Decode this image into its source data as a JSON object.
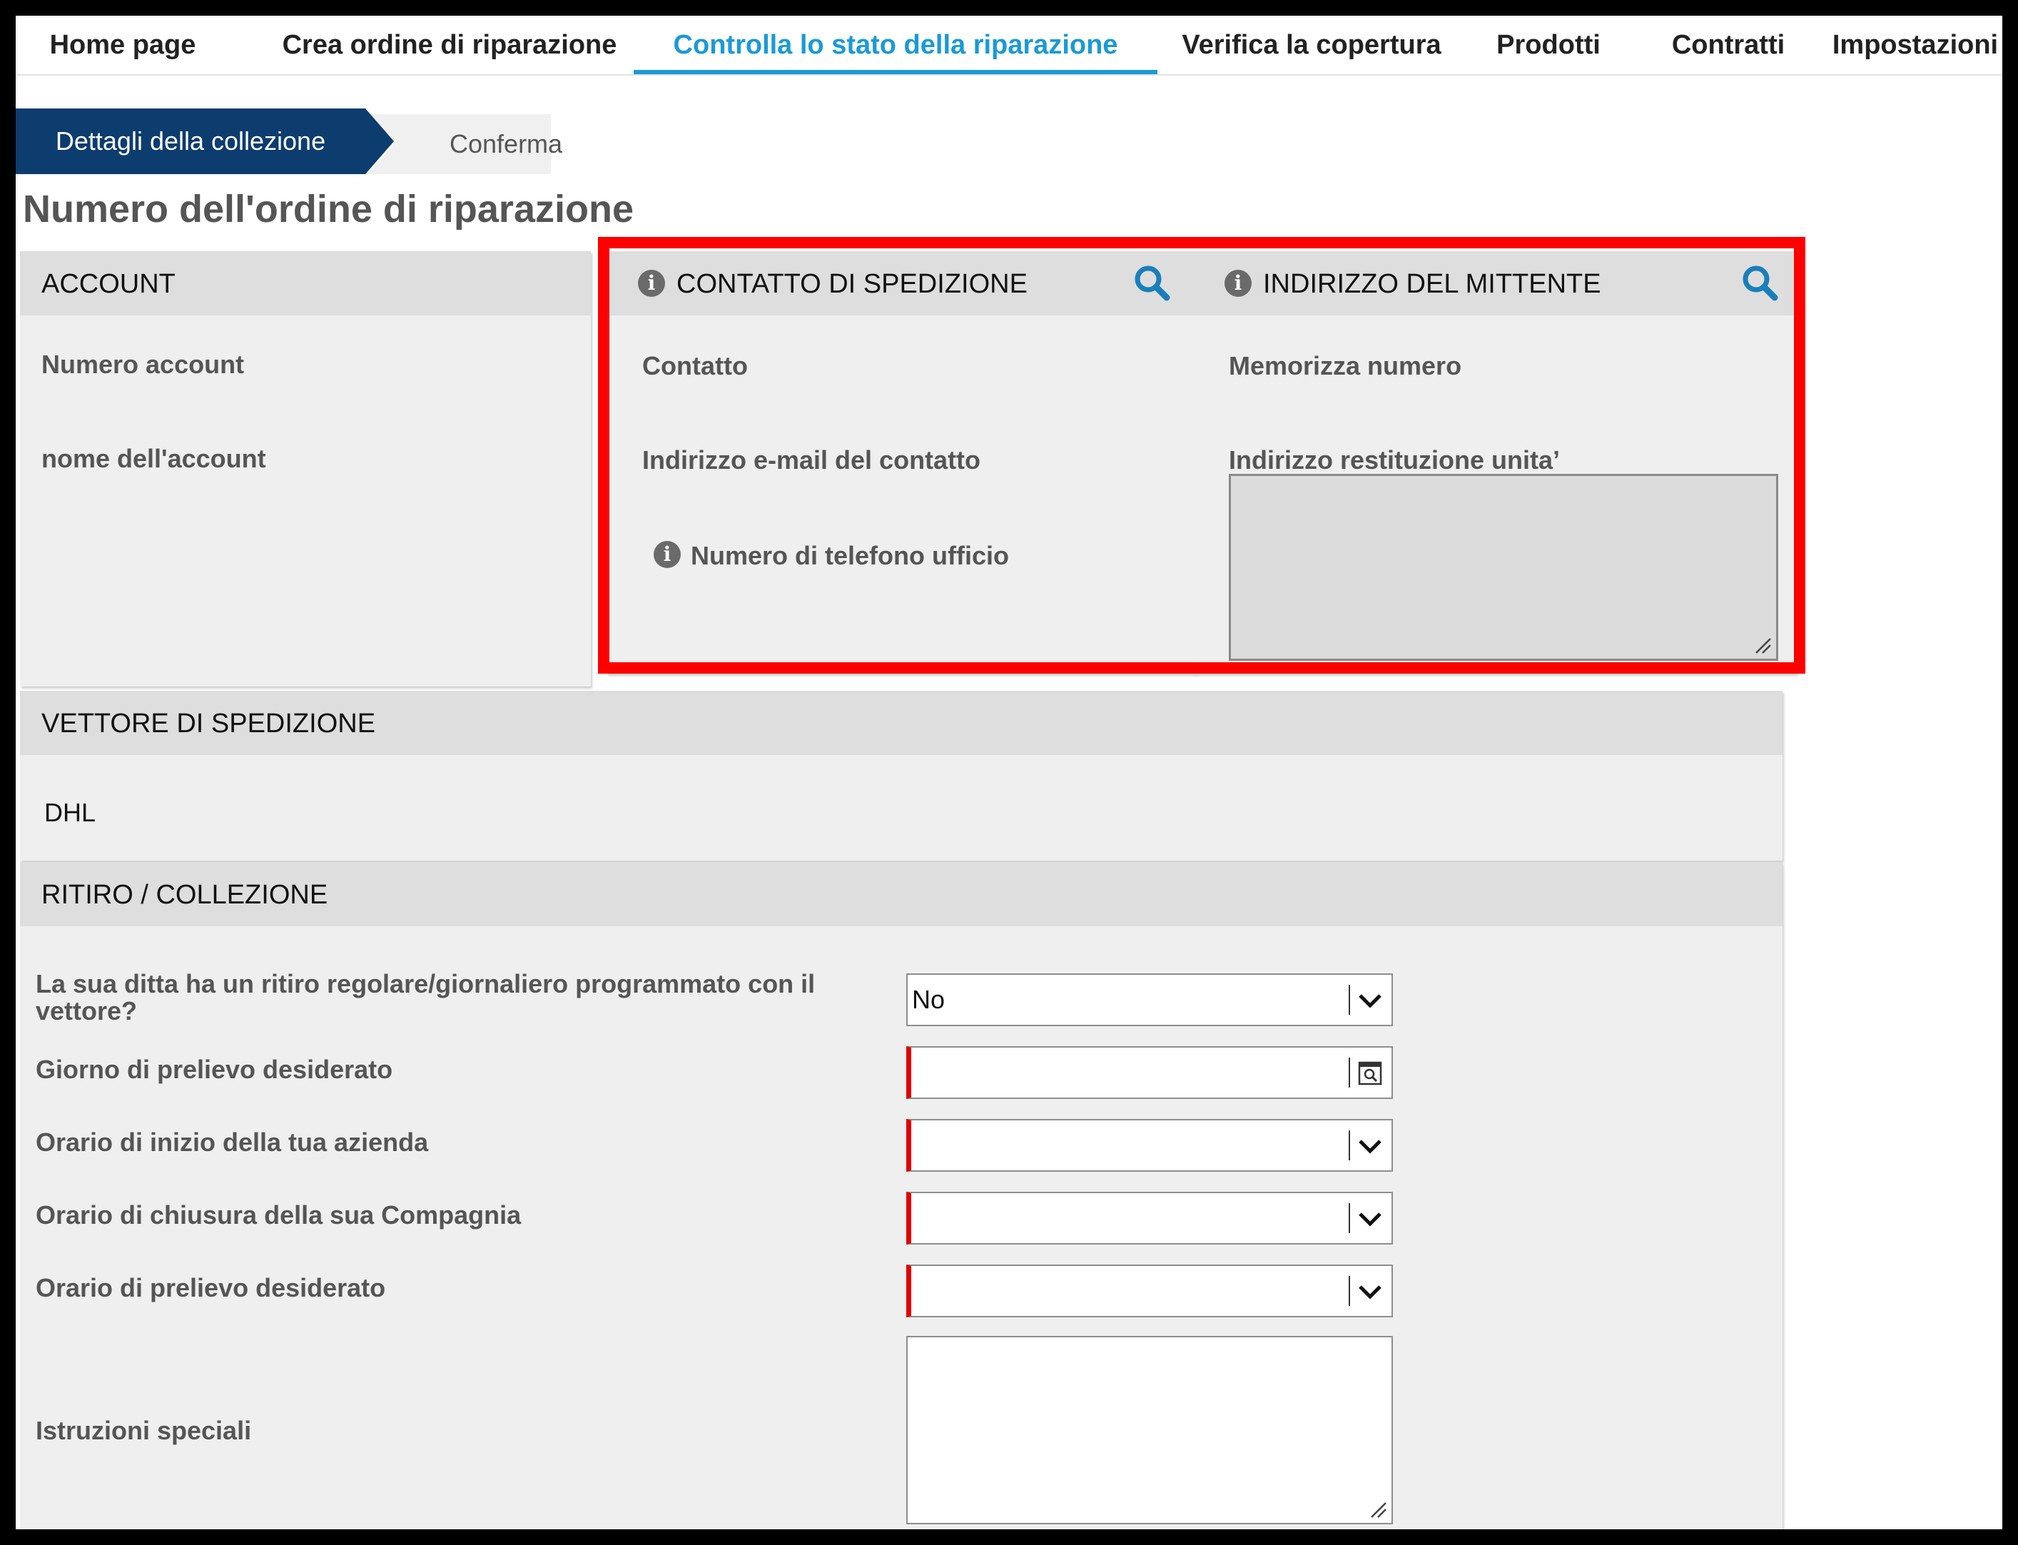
{
  "nav": {
    "tabs": [
      {
        "label": "Home page"
      },
      {
        "label": "Crea ordine di riparazione"
      },
      {
        "label": "Controlla lo stato della riparazione"
      },
      {
        "label": "Verifica la copertura"
      },
      {
        "label": "Prodotti"
      },
      {
        "label": "Contratti"
      },
      {
        "label": "Impostazioni"
      }
    ],
    "active_index": 2
  },
  "steps": [
    {
      "label": "Dettagli della collezione",
      "active": true
    },
    {
      "label": "Conferma",
      "active": false
    }
  ],
  "page_title": "Numero dell'ordine di riparazione",
  "account": {
    "header": "ACCOUNT",
    "fields": [
      "Numero account",
      "nome dell'account"
    ]
  },
  "shipping_contact": {
    "header": "CONTATTO DI SPEDIZIONE",
    "fields": [
      "Contatto",
      "Indirizzo e-mail del contatto",
      "Numero di telefono ufficio"
    ]
  },
  "sender_address": {
    "header": "INDIRIZZO DEL MITTENTE",
    "fields": [
      "Memorizza numero",
      "Indirizzo restituzione unita’"
    ]
  },
  "carrier": {
    "header": "VETTORE DI SPEDIZIONE",
    "value": "DHL"
  },
  "pickup": {
    "header": "RITIRO / COLLEZIONE",
    "regular_pickup_label": "La sua ditta ha un ritiro regolare/giornaliero programmato con il vettore?",
    "regular_pickup_value": "No",
    "pickup_day_label": "Giorno di prelievo desiderato",
    "open_time_label": "Orario di inizio della tua azienda",
    "close_time_label": "Orario di chiusura della sua Compagnia",
    "pickup_time_label": "Orario di prelievo desiderato",
    "instructions_label": "Istruzioni speciali"
  },
  "colors": {
    "accent": "#1a9ad6",
    "step_active": "#0d3c6e",
    "highlight": "#ff0000",
    "required": "#e00000"
  }
}
